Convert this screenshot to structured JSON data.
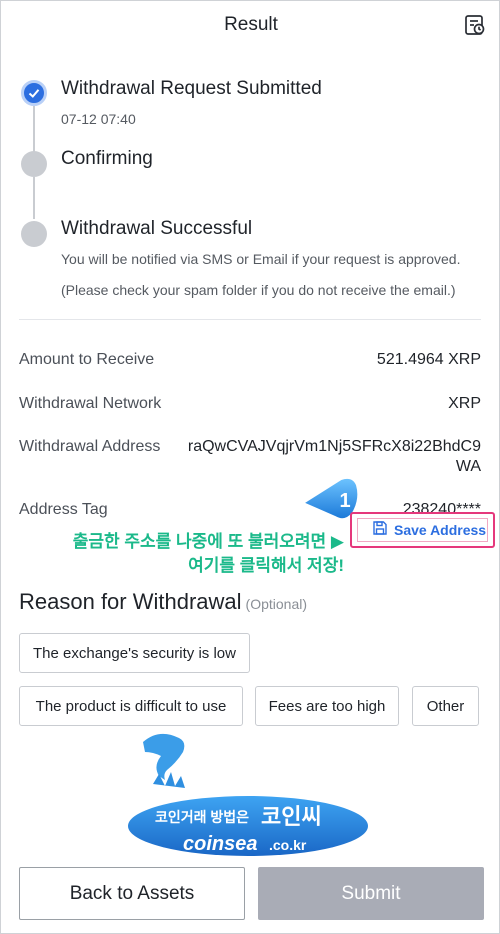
{
  "header": {
    "title": "Result"
  },
  "timeline": {
    "steps": [
      {
        "title": "Withdrawal Request Submitted",
        "time": "07-12 07:40"
      },
      {
        "title": "Confirming"
      },
      {
        "title": "Withdrawal Successful",
        "note1": "You will be notified via SMS or Email if your request is approved.",
        "note2": "(Please check your spam folder if you do not receive the email.)"
      }
    ]
  },
  "details": {
    "amount_label": "Amount to Receive",
    "amount_value": "521.4964 XRP",
    "network_label": "Withdrawal Network",
    "network_value": "XRP",
    "address_label": "Withdrawal Address",
    "address_value": "raQwCVAJVqjrVm1Nj5SFRcX8i22BhdC9WA",
    "tag_label": "Address Tag",
    "tag_value": "238240****"
  },
  "annotation": {
    "badge_number": "1",
    "note_line1": "출금한 주소를 나중에 또 불러오려면 ▶",
    "note_line2": "여기를 클릭해서 저장!"
  },
  "save_address": {
    "label": "Save Address"
  },
  "reason": {
    "title": "Reason for Withdrawal",
    "optional": "(Optional)",
    "options": [
      "The exchange's security is low",
      "The product is difficult to use",
      "Fees are too high",
      "Other"
    ]
  },
  "watermark": {
    "korean": "코인거래 방법은",
    "brand_ko": "코인씨",
    "domain_main": "coinsea",
    "domain_tld": ".co.kr"
  },
  "buttons": {
    "back": "Back to Assets",
    "submit": "Submit"
  },
  "colors": {
    "accent": "#2c6ee0",
    "pending": "#c9ccd1",
    "highlight": "#e5387c",
    "note": "#1bb98a"
  }
}
